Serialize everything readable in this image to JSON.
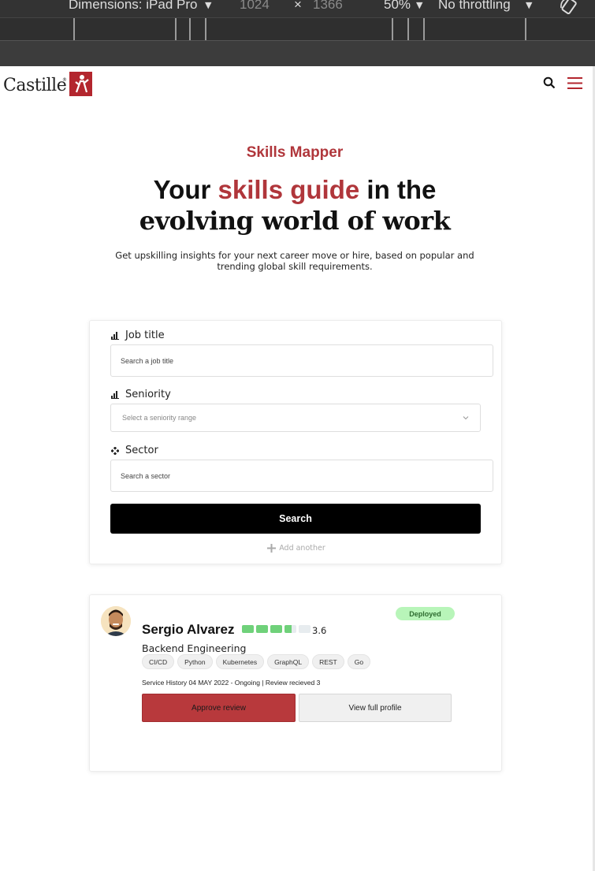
{
  "devtools": {
    "dimensions_label": "Dimensions: iPad Pro",
    "width_value": "1024",
    "times": "×",
    "height_value": "1366",
    "zoom": "50%",
    "throttling": "No throttling"
  },
  "site": {
    "logo_text": "Castille",
    "logo_registered": "®"
  },
  "hero": {
    "eyebrow": "Skills Mapper",
    "headline_part1": "Your",
    "headline_accent": "skills guide",
    "headline_part2": "in the",
    "headline_line2": "evolving world of work",
    "subline": "Get upskilling insights for your next career move or hire, based on popular and trending global skill requirements."
  },
  "search_form": {
    "job_title_label": "Job title",
    "job_title_placeholder": "Search a job title",
    "seniority_label": "Seniority",
    "seniority_placeholder": "Select a seniority range",
    "sector_label": "Sector",
    "sector_placeholder": "Search a sector",
    "search_button": "Search",
    "add_another": "Add another"
  },
  "profile": {
    "name": "Sergio Alvarez",
    "rating": "3.6",
    "rating_fraction": 0.72,
    "status": "Deployed",
    "role": "Backend Engineering",
    "tags": [
      "CI/CD",
      "Python",
      "Kubernetes",
      "GraphQL",
      "REST",
      "Go"
    ],
    "history": "Service History 04 MAY 2022 - Ongoing |   Review recieved   3",
    "approve_button": "Approve review",
    "view_button": "View full profile"
  },
  "colors": {
    "brand": "#b3262e",
    "accent_text": "#b0363b",
    "status_green": "#b8f5b9",
    "rating_green": "#6fd17a"
  },
  "icons": [
    "rotate-icon",
    "search-icon",
    "menu-icon",
    "bar-chart-icon",
    "diamond-icon",
    "chevron-down-icon",
    "plus-icon",
    "avatar"
  ]
}
